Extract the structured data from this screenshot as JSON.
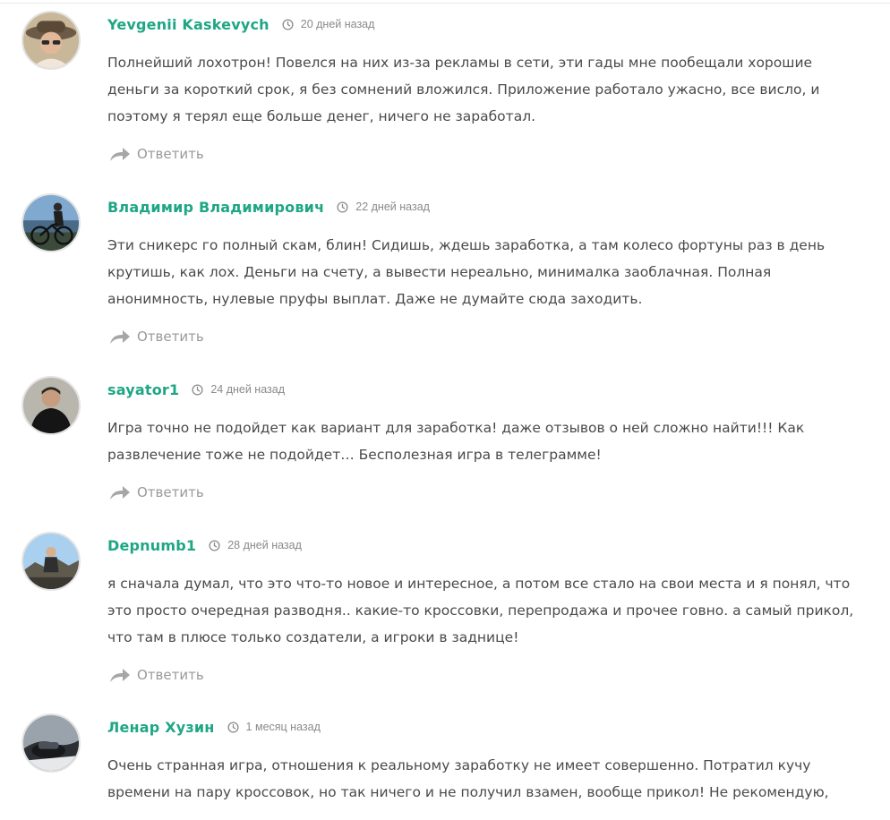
{
  "comments": [
    {
      "author": "Yevgenii Kaskevych",
      "time": "20 дней назад",
      "lines": [
        "Полнейший лохотрон! Повелся на них из-за рекламы в сети, эти гады мне пообещали хорошие",
        "деньги за короткий срок, я без сомнений вложился. Приложение работало ужасно, все висло, и",
        "поэтому я терял еще больше денег, ничего не заработал."
      ],
      "reply_label": "Ответить"
    },
    {
      "author": "Владимир Владимирович",
      "time": "22 дней назад",
      "lines": [
        "Эти сникерс го полный скам, блин! Сидишь, ждешь заработка, а там колесо фортуны раз в день",
        "крутишь, как лох. Деньги на счету, а вывести нереально, минималка заоблачная. Полная",
        "анонимность, нулевые пруфы выплат. Даже не думайте сюда заходить."
      ],
      "reply_label": "Ответить"
    },
    {
      "author": "sayator1",
      "time": "24 дней назад",
      "lines": [
        "Игра точно не подойдет как вариант для заработка! даже отзывов о ней сложно найти!!! Как",
        "развлечение тоже не подойдет… Бесполезная игра в телеграмме!"
      ],
      "reply_label": "Ответить"
    },
    {
      "author": "Depnumb1",
      "time": "28 дней назад",
      "lines": [
        "я сначала думал, что это что-то новое и интересное, а потом все стало на свои места и я понял, что",
        "это просто очередная разводня.. какие-то кроссовки, перепродажа и прочее говно. а самый прикол,",
        "что там в плюсе только создатели, а игроки в заднице!"
      ],
      "reply_label": "Ответить"
    },
    {
      "author": "Ленар Хузин",
      "time": "1 месяц назад",
      "lines": [
        "Очень странная игра, отношения к реальному заработку не имеет совершенно. Потратил кучу",
        "времени на пару кроссовок, но так ничего и не получил взамен, вообще прикол! Не рекомендую,"
      ],
      "reply_label": ""
    }
  ],
  "icons": {
    "clock": "clock-icon",
    "reply": "reply-arrow-icon"
  },
  "colors": {
    "author": "#1ea685",
    "meta": "#8a8a8a",
    "text": "#4a4a4a",
    "reply": "#999999"
  }
}
